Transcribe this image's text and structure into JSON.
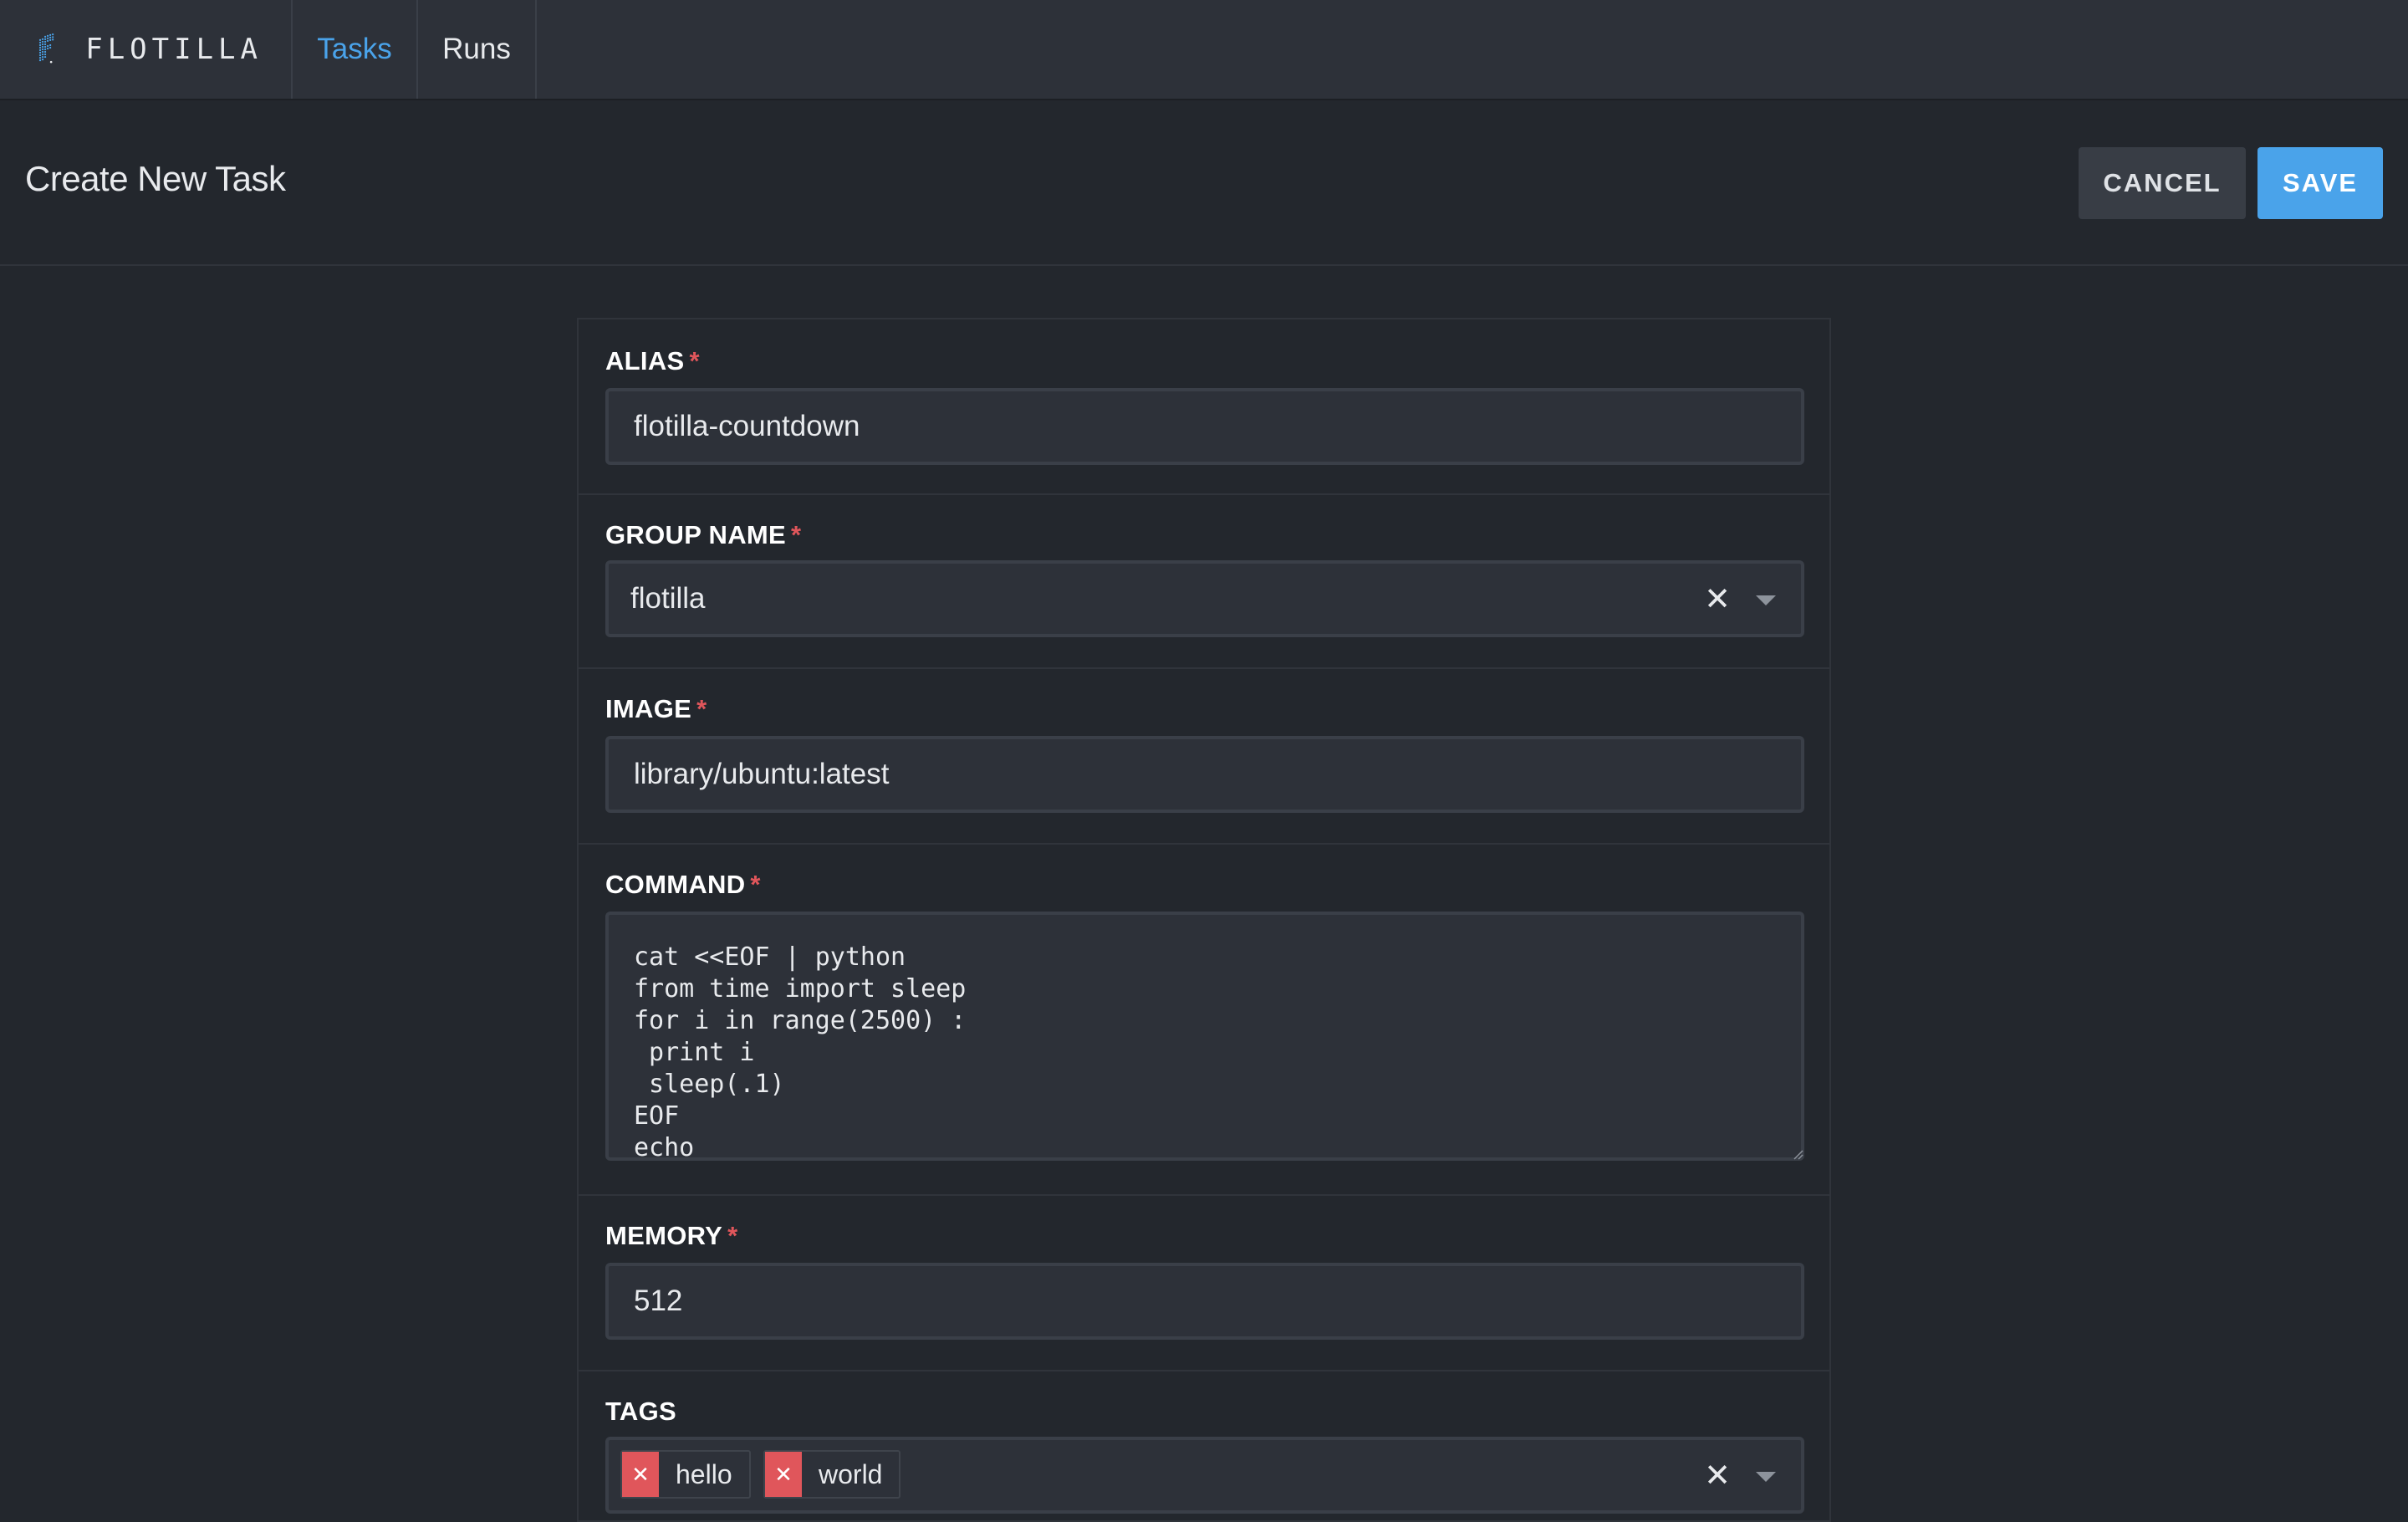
{
  "app": {
    "name": "FLOTILLA"
  },
  "nav": {
    "items": [
      {
        "label": "Tasks",
        "active": true
      },
      {
        "label": "Runs",
        "active": false
      }
    ]
  },
  "header": {
    "title": "Create New Task",
    "cancel_label": "CANCEL",
    "save_label": "SAVE"
  },
  "form": {
    "alias": {
      "label": "ALIAS",
      "required_mark": "*",
      "value": "flotilla-countdown"
    },
    "group_name": {
      "label": "GROUP NAME",
      "required_mark": "*",
      "value": "flotilla",
      "clear_symbol": "✕"
    },
    "image": {
      "label": "IMAGE",
      "required_mark": "*",
      "value": "library/ubuntu:latest"
    },
    "command": {
      "label": "COMMAND",
      "required_mark": "*",
      "value": "cat <<EOF | python\nfrom time import sleep\nfor i in range(2500) :\n print i\n sleep(.1)\nEOF\necho"
    },
    "memory": {
      "label": "MEMORY",
      "required_mark": "*",
      "value": "512"
    },
    "tags": {
      "label": "TAGS",
      "items": [
        "hello",
        "world"
      ],
      "remove_symbol": "✕",
      "clear_symbol": "✕"
    }
  },
  "colors": {
    "accent": "#4aa3ea",
    "required": "#e0565b",
    "background": "#23272d",
    "nav_background": "#2d3139"
  }
}
